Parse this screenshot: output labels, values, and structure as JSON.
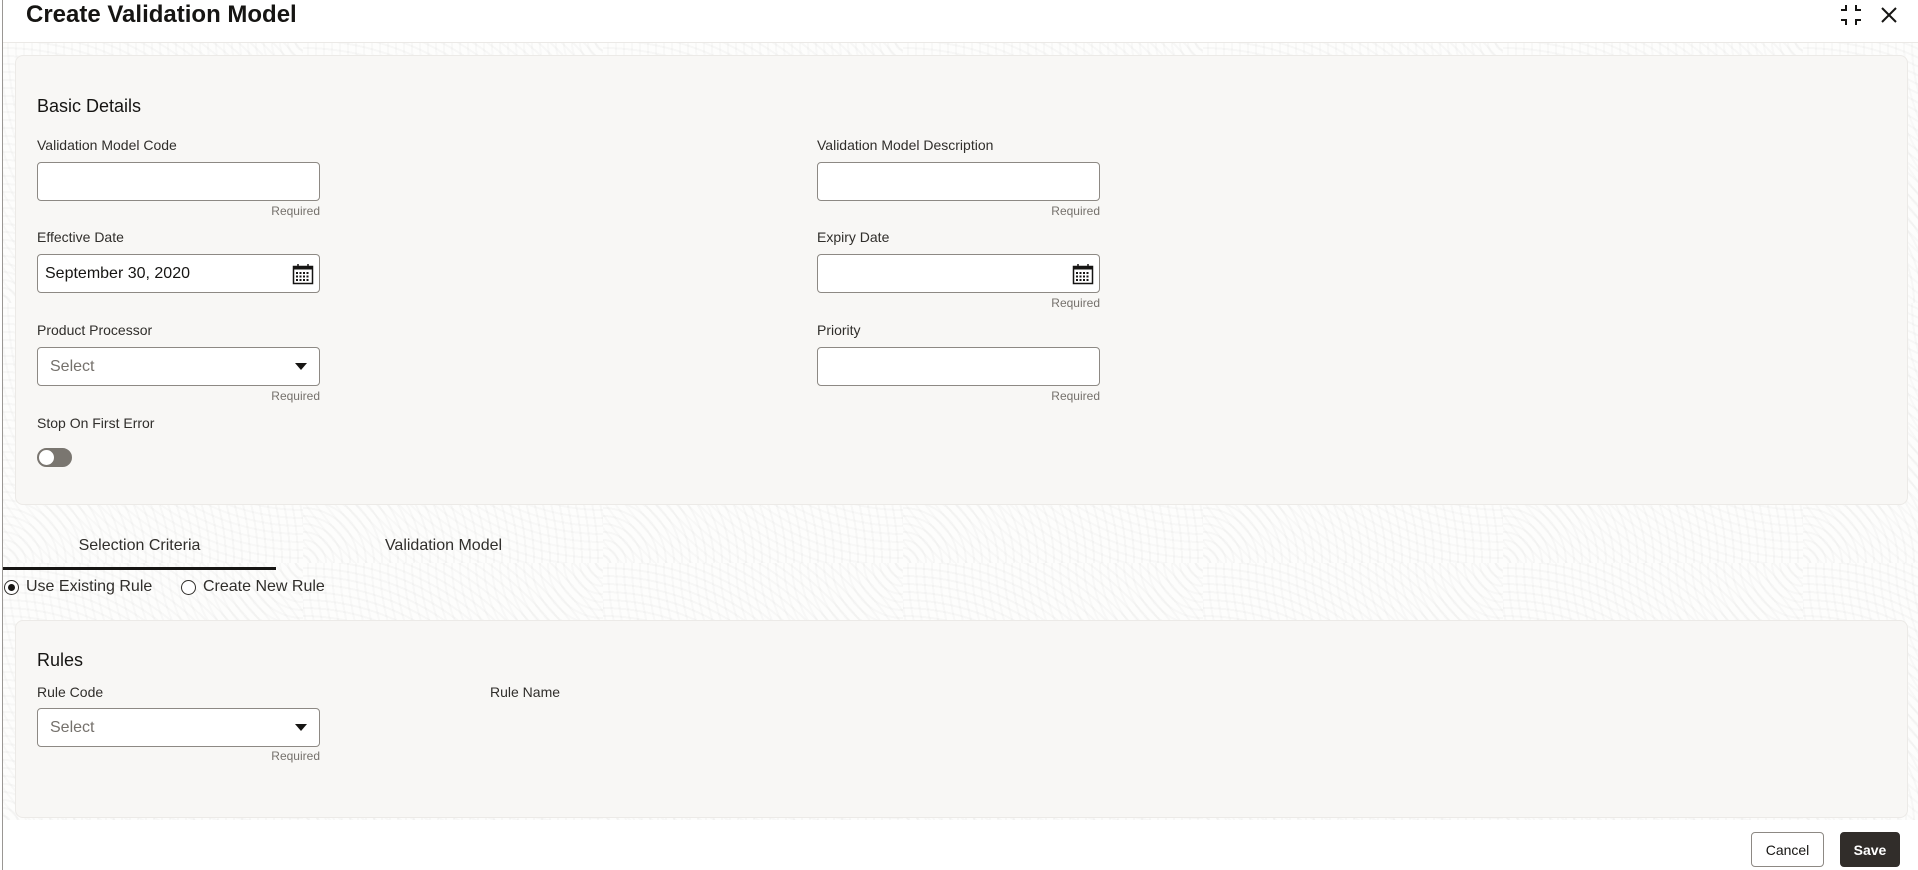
{
  "header": {
    "title": "Create Validation Model",
    "icons": [
      "collapse-icon",
      "close-icon"
    ]
  },
  "basic_details": {
    "section_title": "Basic Details",
    "fields": {
      "validation_model_code": {
        "label": "Validation Model Code",
        "value": "",
        "hint": "Required"
      },
      "validation_model_description": {
        "label": "Validation Model Description",
        "value": "",
        "hint": "Required"
      },
      "effective_date": {
        "label": "Effective Date",
        "value": "September 30, 2020",
        "icon": "calendar-icon"
      },
      "expiry_date": {
        "label": "Expiry Date",
        "value": "",
        "hint": "Required",
        "icon": "calendar-icon"
      },
      "product_processor": {
        "label": "Product Processor",
        "placeholder": "Select",
        "hint": "Required"
      },
      "priority": {
        "label": "Priority",
        "value": "",
        "hint": "Required"
      },
      "stop_on_first_error": {
        "label": "Stop On First Error",
        "checked": false
      }
    }
  },
  "tabs": [
    {
      "label": "Selection Criteria",
      "active": true
    },
    {
      "label": "Validation Model",
      "active": false
    }
  ],
  "rule_options": [
    {
      "label": "Use Existing Rule",
      "checked": true
    },
    {
      "label": "Create New Rule",
      "checked": false
    }
  ],
  "rules": {
    "section_title": "Rules",
    "rule_code": {
      "label": "Rule Code",
      "placeholder": "Select",
      "hint": "Required"
    },
    "rule_name": {
      "label": "Rule Name"
    }
  },
  "footer": {
    "cancel_label": "Cancel",
    "save_label": "Save"
  }
}
